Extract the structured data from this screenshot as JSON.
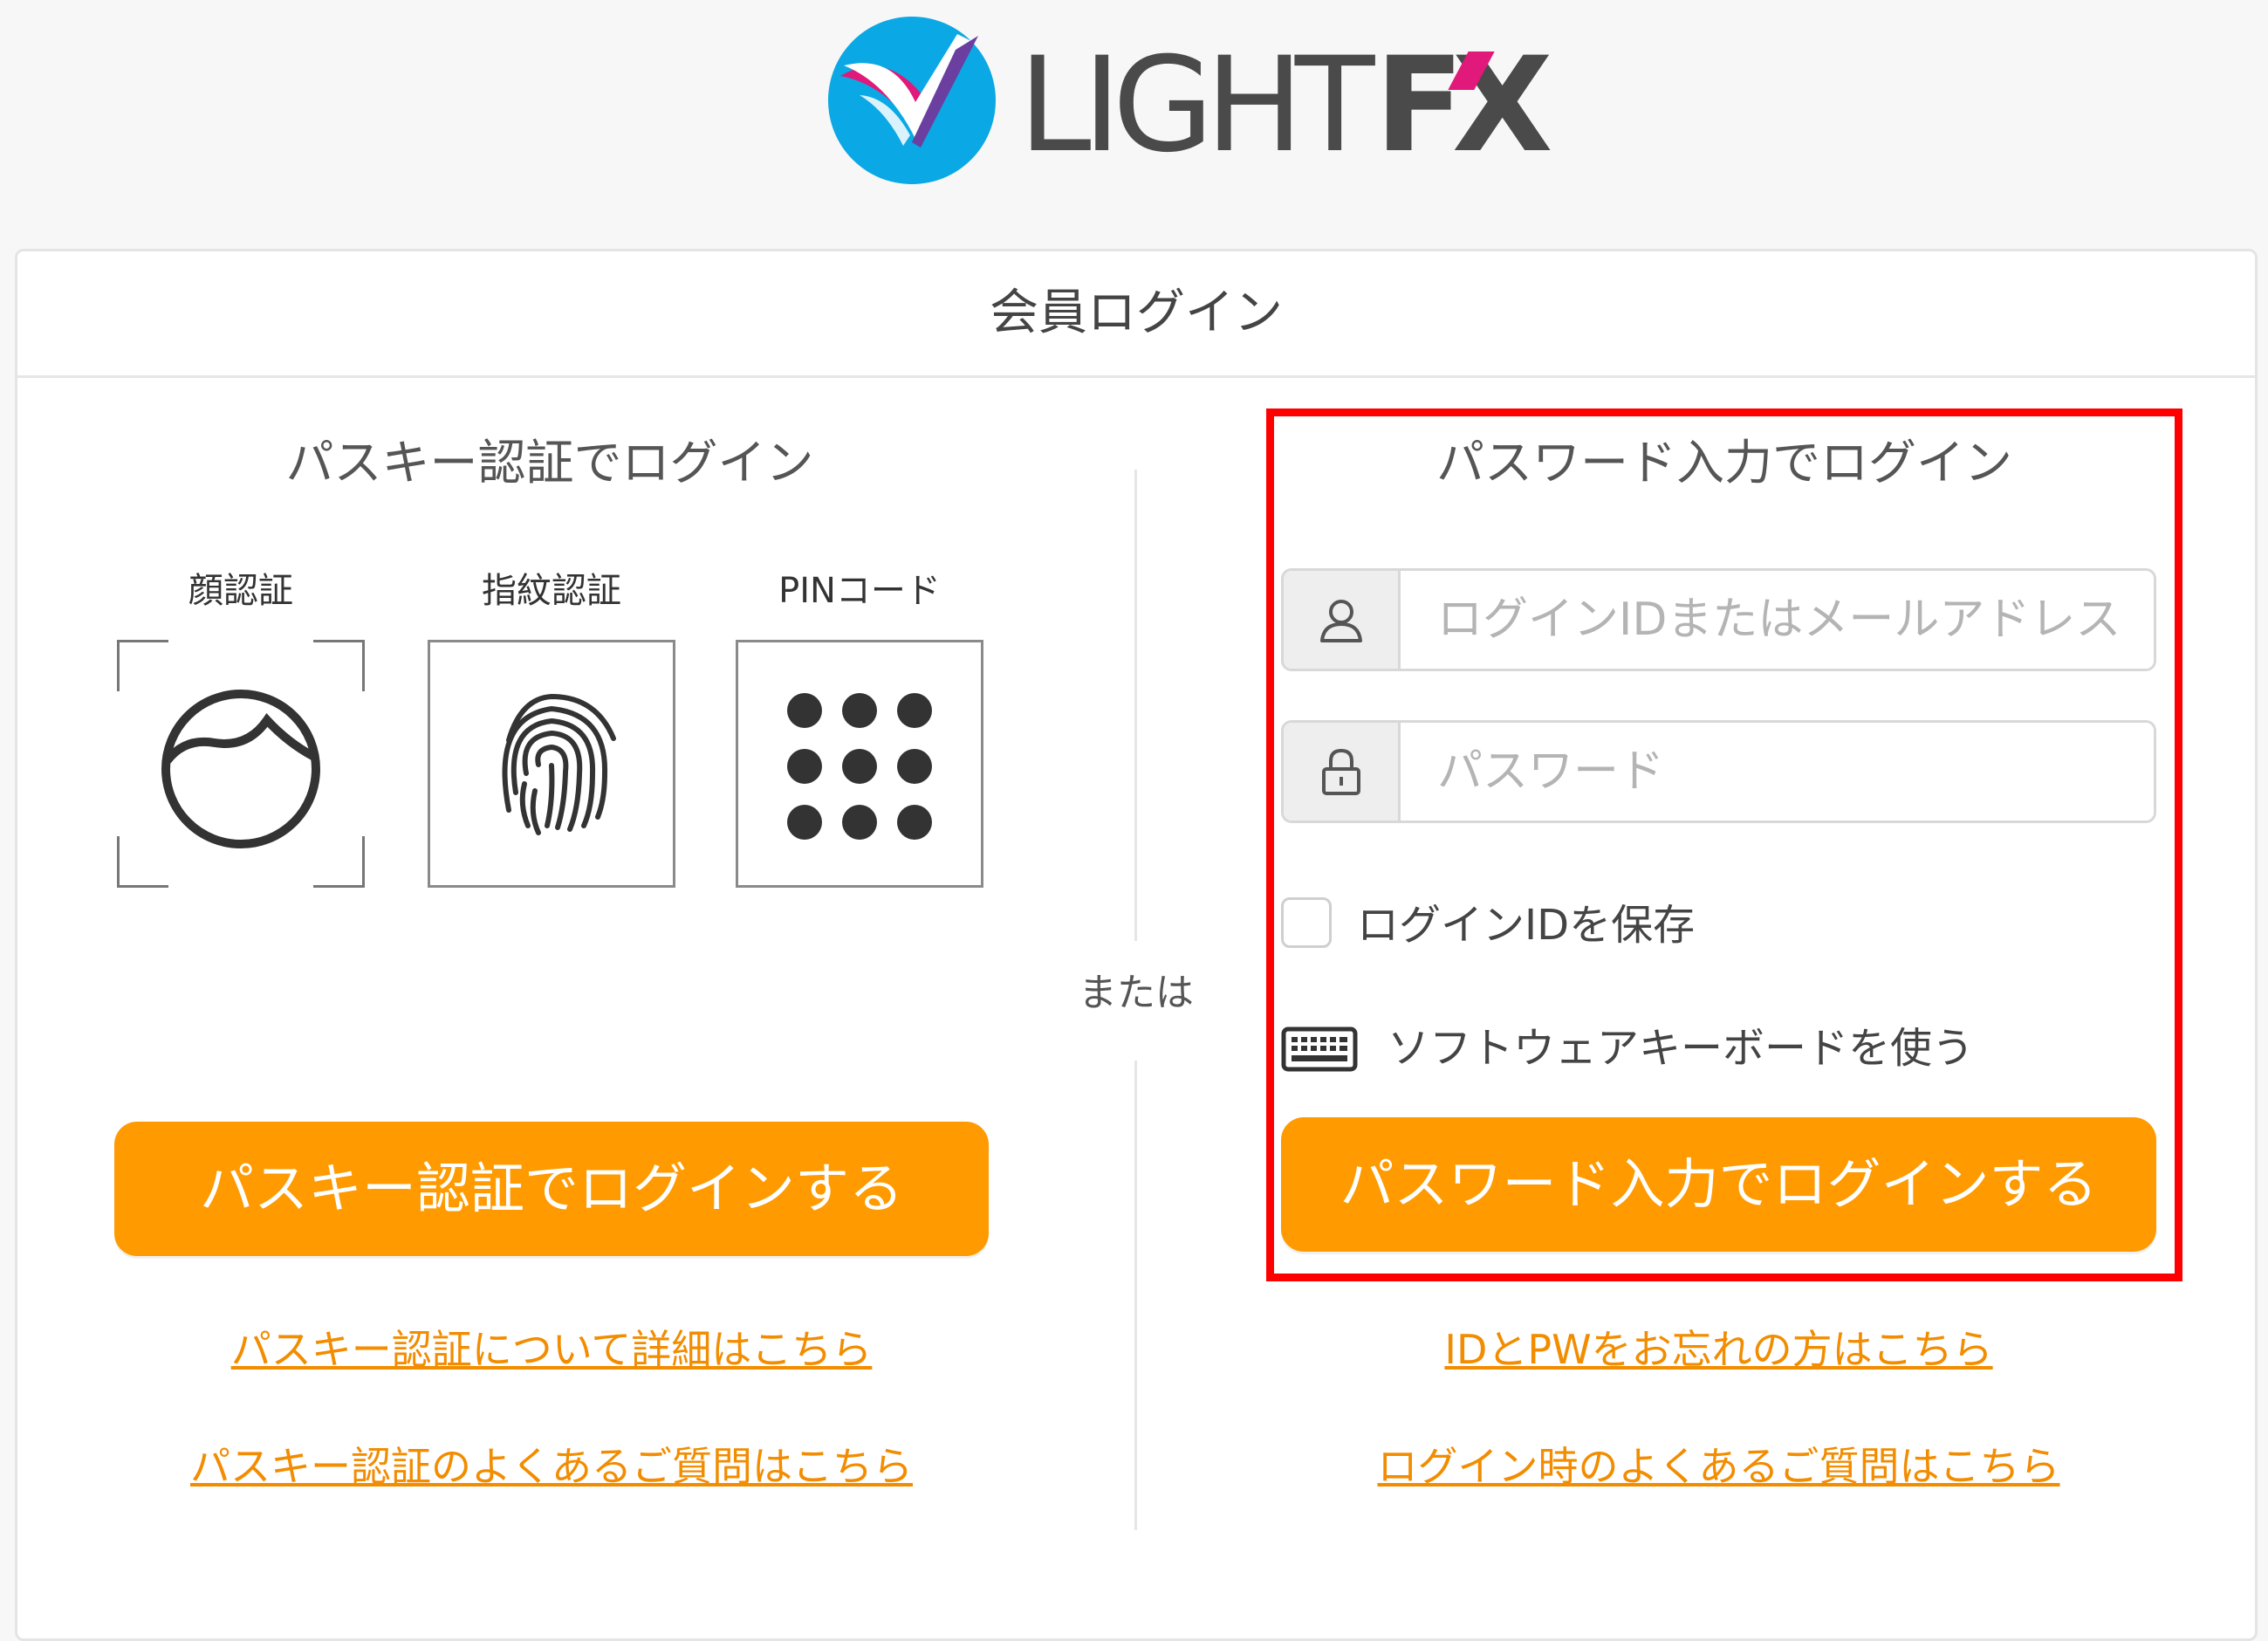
{
  "brand": {
    "name": "LIGHT FX",
    "word_light": "LIGHT",
    "word_fx": "FX"
  },
  "card": {
    "title": "会員ログイン"
  },
  "passkey": {
    "title": "パスキー認証でログイン",
    "methods": [
      {
        "label": "顔認証",
        "icon": "face-icon"
      },
      {
        "label": "指紋認証",
        "icon": "fingerprint-icon"
      },
      {
        "label": "PINコード",
        "icon": "pin-keypad-icon"
      }
    ],
    "login_button": "パスキー認証でログインする",
    "link_details": "パスキー認証について詳細はこちら",
    "link_faq": "パスキー認証のよくあるご質問はこちら"
  },
  "divider": {
    "or_label": "または"
  },
  "password": {
    "title": "パスワード入力でログイン",
    "login_id_placeholder": "ログインIDまたはメールアドレス",
    "login_id_value": "",
    "password_placeholder": "パスワード",
    "password_value": "",
    "save_id_label": "ログインIDを保存",
    "save_id_checked": false,
    "soft_keyboard_label": "ソフトウェアキーボードを使う",
    "login_button": "パスワード入力でログインする",
    "link_forgot": "IDとPWをお忘れの方はこちら",
    "link_faq": "ログイン時のよくあるご質問はこちら"
  },
  "colors": {
    "accent": "#ff9a00",
    "link": "#f28c00",
    "highlight_frame": "#ff0000",
    "logo_blue": "#0aa8e4",
    "logo_pink": "#e0197a",
    "logo_text": "#4a4a4a"
  }
}
